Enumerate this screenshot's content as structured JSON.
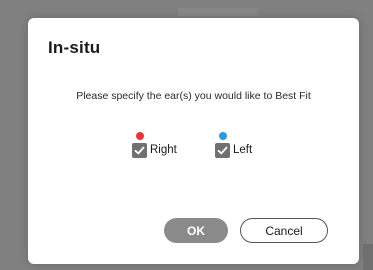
{
  "dialog": {
    "title": "In-situ",
    "message": "Please specify the ear(s) you would like to Best Fit",
    "ears": [
      {
        "label": "Right",
        "checked": true,
        "dot_color": "#e8343a"
      },
      {
        "label": "Left",
        "checked": true,
        "dot_color": "#2a9be0"
      }
    ],
    "ok_label": "OK",
    "cancel_label": "Cancel"
  },
  "colors": {
    "ok_button": "#8a8a8a",
    "checkbox": "#707070",
    "backdrop": "#808080"
  }
}
